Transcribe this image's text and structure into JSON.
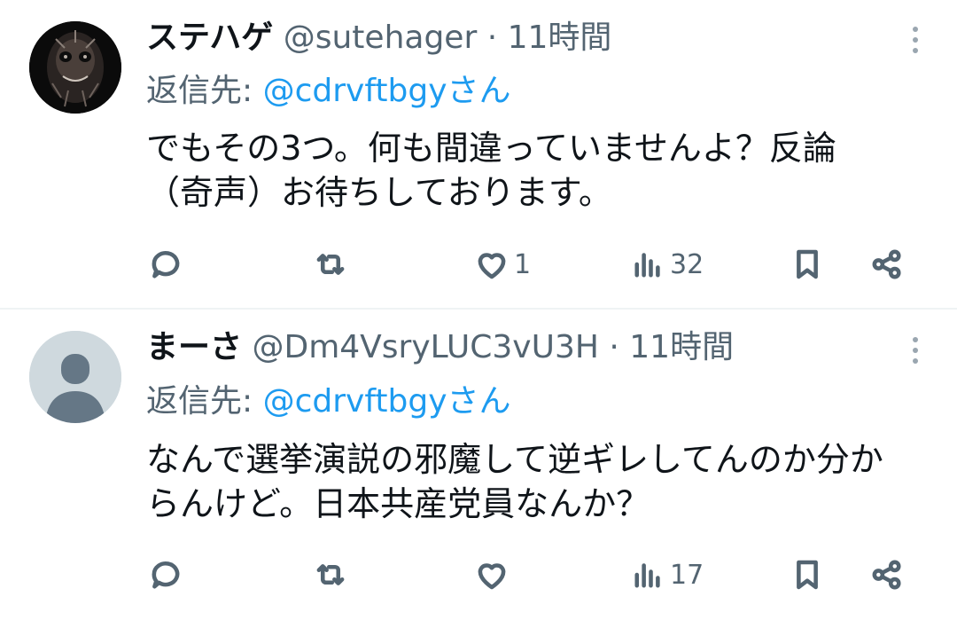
{
  "tweets": [
    {
      "name": "ステハゲ",
      "handle": "@sutehager",
      "time": "· 11時間",
      "reply_prefix": "返信先:",
      "reply_to": "@cdrvftbgyさん",
      "text_lines": [
        "でもその3つ。何も間違っていませんよ？反論",
        "（奇声）お待ちしております。"
      ],
      "replies": "",
      "retweets": "",
      "likes": "1",
      "views": "32"
    },
    {
      "name": "まーさ",
      "handle": "@Dm4VsryLUC3vU3H",
      "time": "· 11時間",
      "reply_prefix": "返信先:",
      "reply_to": "@cdrvftbgyさん",
      "text_lines": [
        "なんで選挙演説の邪魔して逆ギレしてんのか分か",
        "らんけど。日本共産党員なんか？"
      ],
      "replies": "",
      "retweets": "",
      "likes": "",
      "views": "17"
    }
  ],
  "icons": {
    "reply": "reply-icon",
    "retweet": "retweet-icon",
    "like": "heart-icon",
    "views": "views-icon",
    "bookmark": "bookmark-icon",
    "share": "share-icon",
    "more": "more-icon"
  },
  "colors": {
    "text": "#0f1419",
    "secondary": "#536471",
    "link": "#1d9bf0",
    "divider": "#eff3f4",
    "default_avatar_bg": "#cfd9de",
    "default_avatar_fg": "#657786"
  }
}
